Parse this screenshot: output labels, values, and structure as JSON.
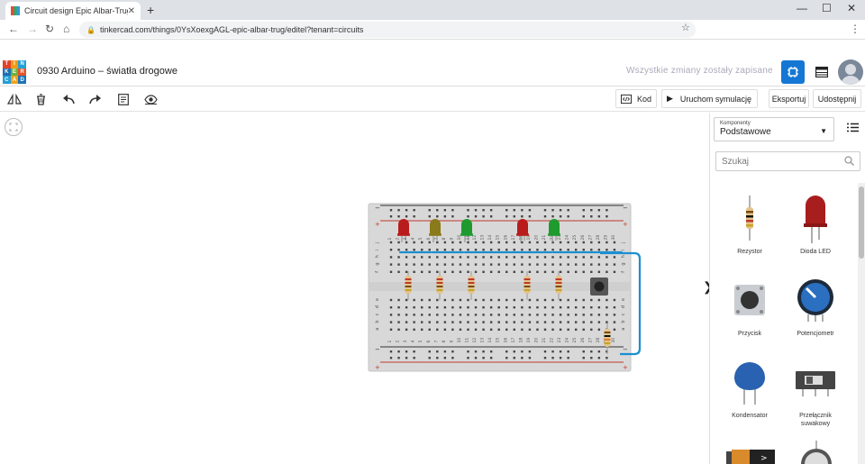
{
  "browser": {
    "tab_title": "Circuit design Epic Albar-Trug | T...",
    "tab_close": "✕",
    "new_tab": "+",
    "url": "tinkercad.com/things/0YsXoexgAGL-epic-albar-trug/editel?tenant=circuits",
    "window_controls": [
      "—",
      "☐",
      "✕"
    ]
  },
  "app": {
    "logo_letters": [
      "TIN",
      "KER",
      "CAD"
    ],
    "logo_colors": [
      "#e2412b",
      "#f29a12",
      "#22a1d6",
      "#1e6fb4",
      "#6bb33d",
      "#e5532a",
      "#239ed7",
      "#f0a11a",
      "#1d73b9"
    ],
    "project_title": "0930 Arduino – światła drogowe",
    "save_status": "Wszystkie zmiany zostały zapisane"
  },
  "toolbar": {
    "code_label": "Kod",
    "simulate_label": "Uruchom symulację",
    "export_label": "Eksportuj",
    "share_label": "Udostępnij"
  },
  "panel": {
    "dropdown_caption": "Komponenty",
    "dropdown_value": "Podstawowe",
    "search_placeholder": "Szukaj",
    "components": [
      {
        "label": "Rezystor",
        "icon": "resistor-icon"
      },
      {
        "label": "Dioda LED",
        "icon": "led-icon"
      },
      {
        "label": "Przycisk",
        "icon": "pushbutton-icon"
      },
      {
        "label": "Potencjometr",
        "icon": "potentiometer-icon"
      },
      {
        "label": "Kondensator",
        "icon": "capacitor-icon"
      },
      {
        "label": "Przełącznik suwakowy",
        "icon": "slide-switch-icon"
      }
    ]
  },
  "breadboard": {
    "column_numbers": [
      "1",
      "2",
      "3",
      "4",
      "5",
      "6",
      "7",
      "8",
      "9",
      "10",
      "11",
      "12",
      "13",
      "14",
      "15",
      "16",
      "17",
      "18",
      "19",
      "20",
      "21",
      "22",
      "23",
      "24",
      "25",
      "26",
      "27",
      "28",
      "29",
      "30"
    ],
    "row_letters_top": [
      "j",
      "i",
      "h",
      "g",
      "f"
    ],
    "row_letters_bottom": [
      "e",
      "d",
      "c",
      "b",
      "a"
    ],
    "led_colors": [
      "#b91c1c",
      "#8a7a1a",
      "#1f9a2e",
      "#b91c1c",
      "#1f9a2e"
    ],
    "wire_color": "#1c8fd0"
  },
  "colors": {
    "accent_blue": "#1e6fb4",
    "selected_view": "#1477d4"
  }
}
